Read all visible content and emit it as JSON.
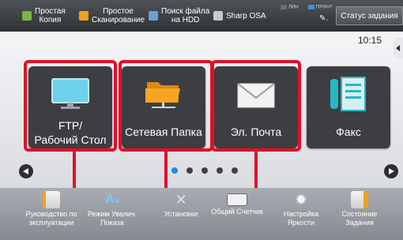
{
  "topbar": {
    "quick": [
      {
        "label": "Простая\nКопия",
        "icon": "copy-icon",
        "color": "#7ab648"
      },
      {
        "label": "Простое\nСканирование",
        "icon": "scan-icon",
        "color": "#f0a21c"
      },
      {
        "label": "Поиск файла\nна HDD",
        "icon": "hdd-search-icon",
        "color": "#6aa0d8"
      },
      {
        "label": "Sharp OSA",
        "icon": "osa-icon",
        "color": "#c7c9cc"
      }
    ],
    "indicator_line": "ЛИН.",
    "indicator_print": "ПРИНТ",
    "status_button": "Статус задания"
  },
  "clock": "10:15",
  "tiles": [
    {
      "label_line1": "FTP/",
      "label_line2": "Рабочий Стол",
      "icon": "monitor-icon"
    },
    {
      "label": "Сетевая Папка",
      "icon": "network-folder-icon"
    },
    {
      "label": "Эл. Почта",
      "icon": "envelope-icon"
    },
    {
      "label": "Факс",
      "icon": "fax-icon"
    }
  ],
  "pager": {
    "total": 5,
    "active": 1
  },
  "bottom": [
    {
      "label": "Руководство по\nэксплуатации",
      "icon": "manual-icon"
    },
    {
      "label": "Режим Увелич.\nПоказа",
      "icon": "enlarge-display-icon"
    },
    {
      "label": "Установки",
      "icon": "settings-tools-icon"
    },
    {
      "label": "Общий Счетчик",
      "icon": "counter-icon"
    },
    {
      "label": "Настройка\nЯркости",
      "icon": "brightness-icon"
    },
    {
      "label": "Состояние\nЗадания",
      "icon": "job-status-icon"
    }
  ],
  "colors": {
    "highlight": "#e0102a",
    "accent": "#1a8fd6"
  }
}
